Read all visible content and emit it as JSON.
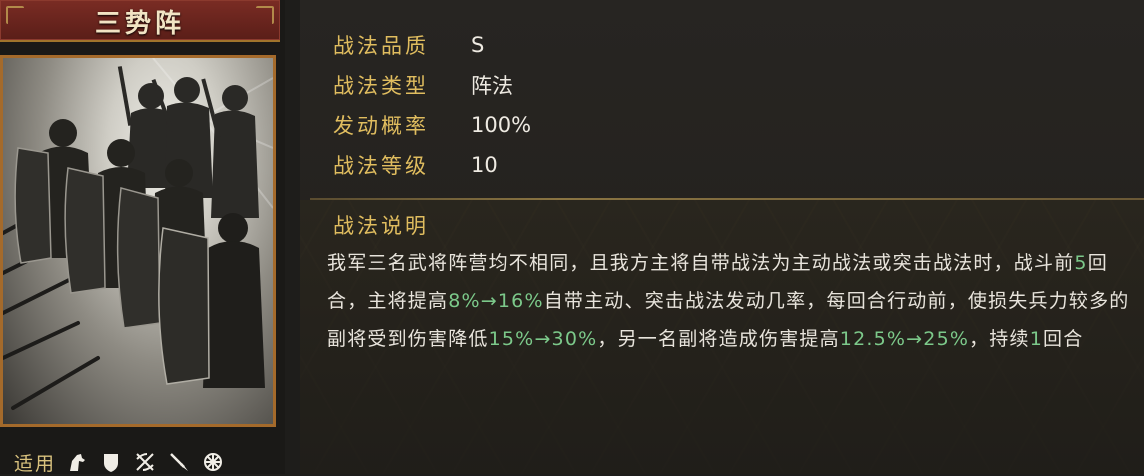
{
  "skill": {
    "name": "三势阵"
  },
  "stats": [
    {
      "label": "战法品质",
      "value": "S"
    },
    {
      "label": "战法类型",
      "value": "阵法"
    },
    {
      "label": "发动概率",
      "value": "100%"
    },
    {
      "label": "战法等级",
      "value": "10"
    }
  ],
  "description": {
    "title": "战法说明",
    "segments": [
      {
        "text": "我军三名武将阵营均不相同，且我方主将自带战法为主动战法或突击战法时，战斗前",
        "highlight": false
      },
      {
        "text": "5",
        "highlight": true
      },
      {
        "text": "回合，主将提高",
        "highlight": false
      },
      {
        "text": "8%→16%",
        "highlight": true
      },
      {
        "text": "自带主动、突击战法发动几率，每回合行动前，使损失兵力较多的副将受到伤害降低",
        "highlight": false
      },
      {
        "text": "15%→30%",
        "highlight": true
      },
      {
        "text": "，另一名副将造成伤害提高",
        "highlight": false
      },
      {
        "text": "12.5%→25%",
        "highlight": true
      },
      {
        "text": "，持续",
        "highlight": false
      },
      {
        "text": "1",
        "highlight": true
      },
      {
        "text": "回合",
        "highlight": false
      }
    ]
  },
  "applicable": {
    "label": "适用",
    "icons": [
      "cavalry-horse-icon",
      "shield-icon",
      "crossed-bows-icon",
      "spear-icon",
      "wheel-icon"
    ]
  },
  "colors": {
    "label_gold": "#e0bd5f",
    "highlight_green": "#7cc98a",
    "title_bar_red": "#6e2720",
    "frame_bronze": "#a46a2b"
  }
}
